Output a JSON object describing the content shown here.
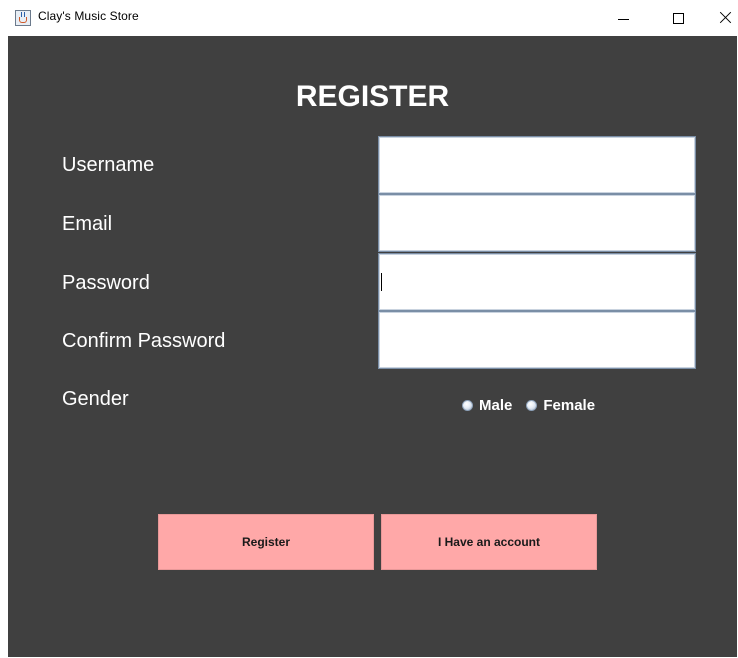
{
  "window": {
    "title": "Clay's Music Store"
  },
  "form": {
    "heading": "REGISTER",
    "username_label": "Username",
    "email_label": "Email",
    "password_label": "Password",
    "confirm_password_label": "Confirm Password",
    "gender_label": "Gender",
    "username_value": "",
    "email_value": "",
    "password_value": "",
    "confirm_password_value": "",
    "gender_options": [
      "Male",
      "Female"
    ],
    "gender_selected": ""
  },
  "buttons": {
    "register_label": "Register",
    "have_account_label": "I Have an account"
  },
  "colors": {
    "panel_background": "#404040",
    "button_background": "#ffa8a8",
    "label_text": "#ffffff"
  }
}
